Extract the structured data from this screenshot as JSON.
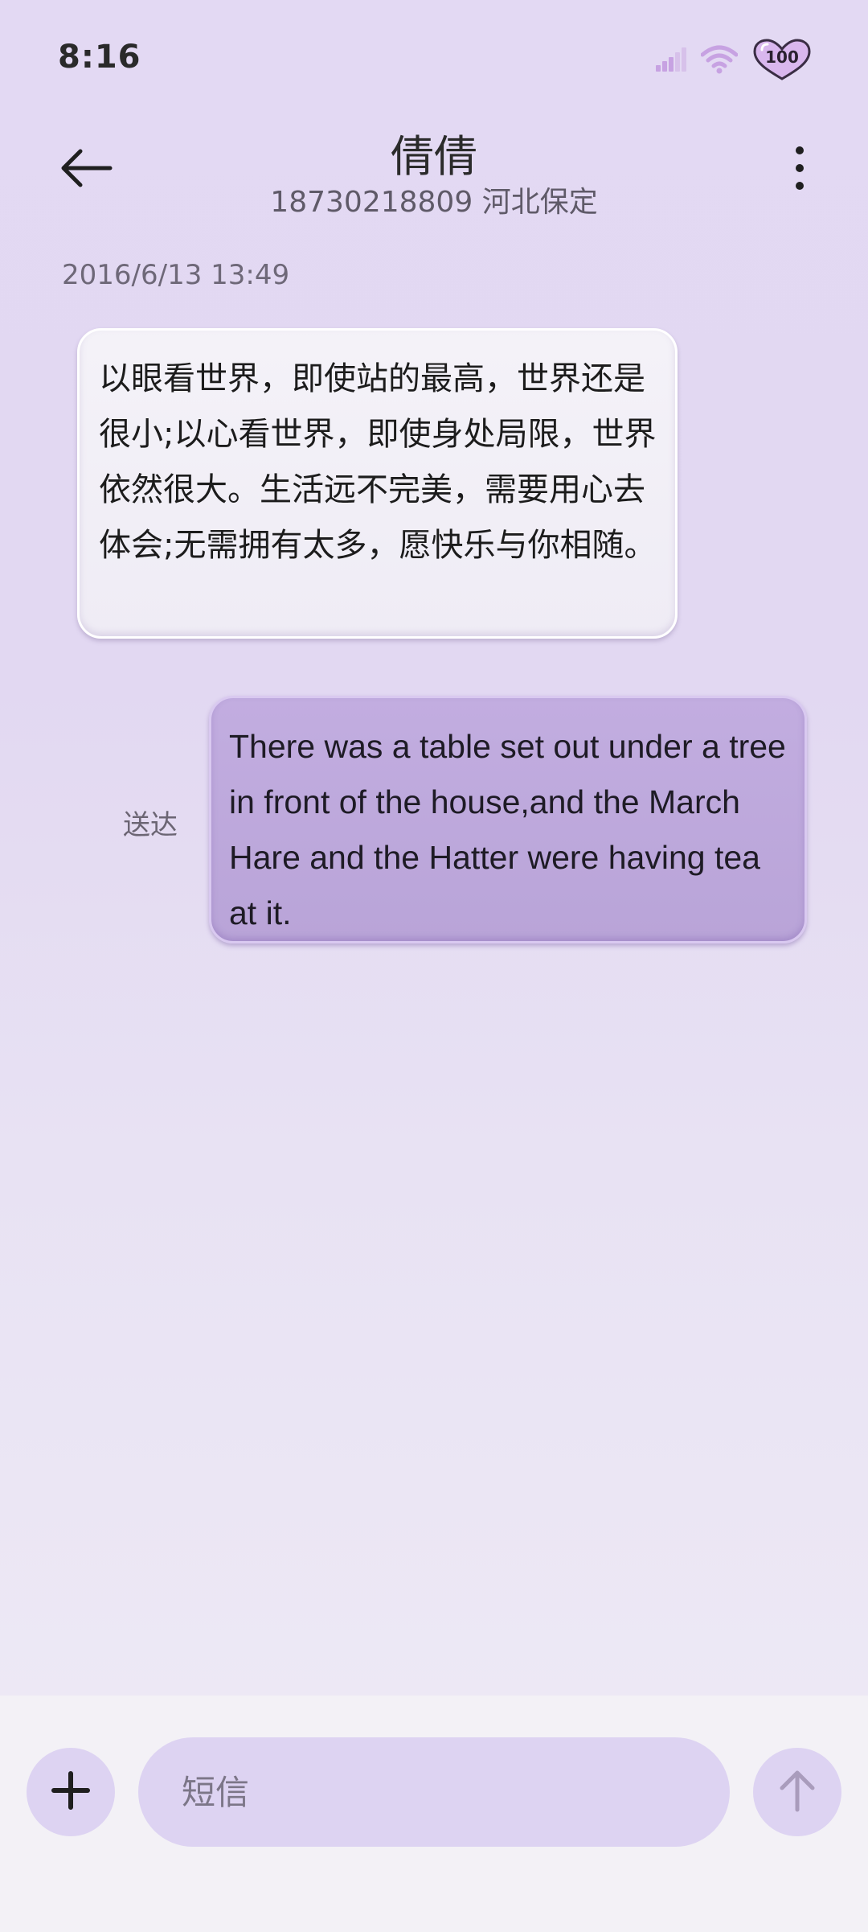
{
  "status_bar": {
    "time": "8:16",
    "battery_level": "100",
    "icons": [
      "signal-icon",
      "wifi-icon",
      "battery-icon"
    ]
  },
  "header": {
    "contact_name": "倩倩",
    "contact_detail": "18730218809 河北保定",
    "back_icon": "arrow-left-icon",
    "more_icon": "more-vertical-icon"
  },
  "conversation": {
    "timestamp": "2016/6/13 13:49",
    "messages": [
      {
        "direction": "incoming",
        "text": "以眼看世界，即使站的最高，世界还是很小;以心看世界，即使身处局限，世界依然很大。生活远不完美，需要用心去体会;无需拥有太多，愿快乐与你相随。"
      },
      {
        "direction": "outgoing",
        "text": "There was a table set out under a tree in front of the house,and the March Hare and the Hatter were having tea at it.",
        "status": "送达"
      }
    ]
  },
  "composer": {
    "placeholder": "短信",
    "value": "",
    "add_icon": "plus-icon",
    "send_icon": "arrow-up-icon"
  },
  "colors": {
    "background": "#e3d9f3",
    "incoming_bubble": "#f1eef6",
    "outgoing_bubble": "#bda8dc",
    "composer_control": "#ddd3f2",
    "accent": "#b27ad6"
  }
}
